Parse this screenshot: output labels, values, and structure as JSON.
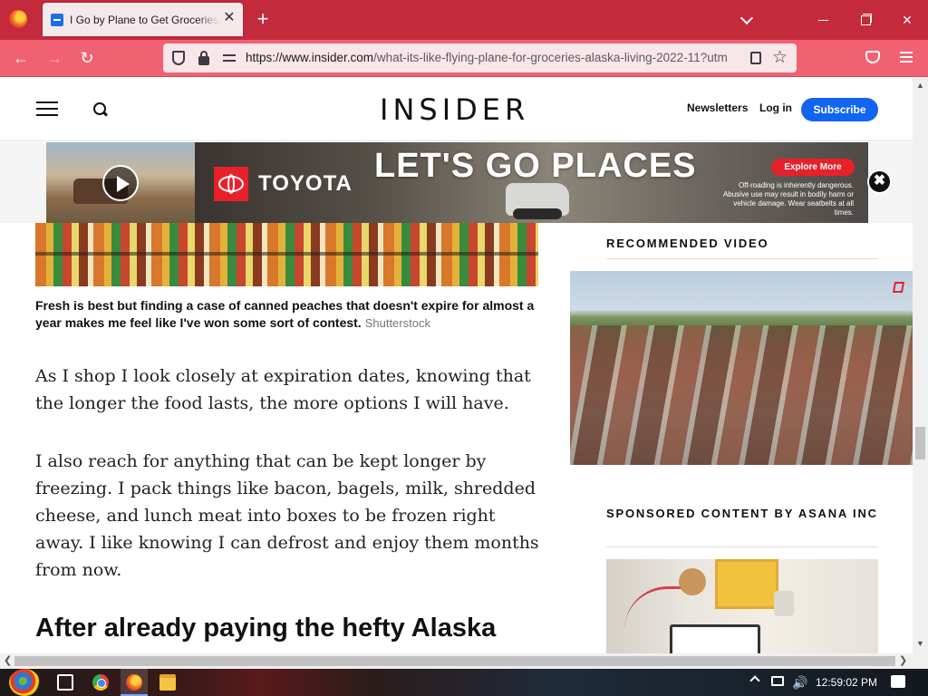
{
  "browser": {
    "tab_title": "I Go by Plane to Get Groceries in Alaska",
    "tab_close": "✕",
    "new_tab": "+",
    "url_host": "https://www.insider.com",
    "url_path": "/what-its-like-flying-plane-for-groceries-alaska-living-2022-11?utm",
    "star": "☆",
    "back": "←",
    "forward": "→",
    "reload": "↻",
    "win_close": "✕"
  },
  "header": {
    "logo": "INSIDER",
    "newsletters": "Newsletters",
    "login": "Log in",
    "subscribe": "Subscribe"
  },
  "ad": {
    "brand": "TOYOTA",
    "headline": "LET'S GO PLACES",
    "cta": "Explore More",
    "disclaimer": "Off-roading is inherently dangerous. Abusive use may result in bodily harm or vehicle damage. Wear seatbelts at all times.",
    "close": "✖"
  },
  "article": {
    "caption": "Fresh is best but finding a case of canned peaches that doesn't expire for almost a year makes me feel like I've won some sort of contest.",
    "credit": "Shutterstock",
    "para1": "As I shop I look closely at expiration dates, knowing that the longer the food lasts, the more options I will have.",
    "para2": "I also reach for anything that can be kept longer by freezing. I pack things like bacon, bagels, milk, shredded cheese, and lunch meat into boxes to be frozen right away. I like knowing I can defrost and enjoy them months from now.",
    "subhead": "After already paying the hefty Alaska"
  },
  "sidebar": {
    "recommended_video": "RECOMMENDED VIDEO",
    "sponsored": "SPONSORED CONTENT BY ASANA INC"
  },
  "scroll": {
    "up": "▲",
    "down": "▼",
    "left": "❮",
    "right": "❯"
  },
  "taskbar": {
    "volume": "🔊",
    "clock": "12:59:02 PM"
  }
}
